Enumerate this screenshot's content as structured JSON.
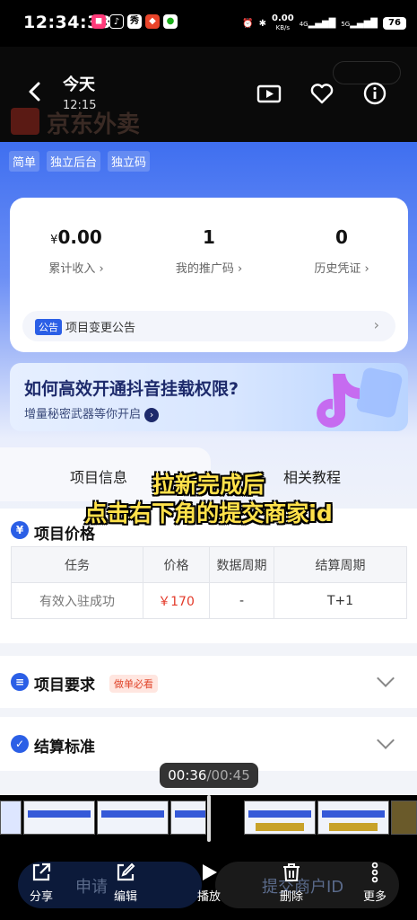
{
  "status_bar": {
    "time": "12:34:33",
    "net_speed": "0.00",
    "net_unit": "KB/s",
    "sig1": "4G",
    "sig2": "5G",
    "battery": "76"
  },
  "viewer": {
    "title": "今天",
    "subtitle": "12:15"
  },
  "underlying": {
    "app_name": "京东外卖"
  },
  "page": {
    "tags": [
      "简单",
      "独立后台",
      "独立码"
    ],
    "stats": [
      {
        "prefix": "¥",
        "value": "0.00",
        "label": "累计收入 ›"
      },
      {
        "prefix": "",
        "value": "1",
        "label": "我的推广码 ›"
      },
      {
        "prefix": "",
        "value": "0",
        "label": "历史凭证 ›"
      }
    ],
    "notice": {
      "badge": "公告",
      "text": "项目变更公告",
      "chevron": "›"
    },
    "banner": {
      "title": "如何高效开通抖音挂载权限?",
      "subtitle": "增量秘密武器等你开启",
      "arrow": "›"
    },
    "tabs": [
      "项目信息",
      "相关教程"
    ],
    "price_section": {
      "icon": "¥",
      "title": "项目价格",
      "headers": [
        "任务",
        "价格",
        "数据周期",
        "结算周期"
      ],
      "row": [
        "有效入驻成功",
        "￥170",
        "-",
        "T+1"
      ]
    },
    "requirements": {
      "title": "项目要求",
      "badge": "做单必看"
    },
    "settlement": {
      "title": "结算标准"
    }
  },
  "caption": {
    "line1": "拉新完成后",
    "line2": "点击右下角的提交商家id"
  },
  "video": {
    "current": "00:36",
    "total": "/00:45"
  },
  "ghost_buttons": {
    "left": "申请",
    "right": "提交商户ID"
  },
  "toolbar": [
    {
      "label": "分享",
      "icon": "share-icon"
    },
    {
      "label": "编辑",
      "icon": "edit-icon"
    },
    {
      "label": "播放",
      "icon": "play-icon"
    },
    {
      "label": "删除",
      "icon": "trash-icon"
    },
    {
      "label": "更多",
      "icon": "more-icon"
    }
  ],
  "colors": {
    "primary": "#2b5fe6",
    "price_red": "#e33a2a",
    "caption_yellow": "#ffe14a"
  }
}
